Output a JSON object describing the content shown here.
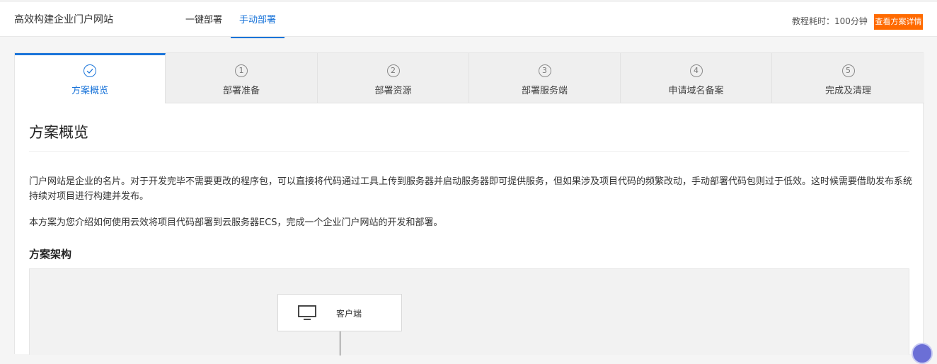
{
  "header": {
    "site_title": "高效构建企业门户网站",
    "tabs": [
      "一键部署",
      "手动部署"
    ],
    "active_tab": "手动部署",
    "time_label": "教程耗时：100分钟",
    "detail_button": "查看方案详情",
    "accent_color": "#1a74d9",
    "button_color": "#ff6a00"
  },
  "steps": [
    {
      "marker": "check-icon",
      "label": "方案概览"
    },
    {
      "marker": "1",
      "label": "部署准备"
    },
    {
      "marker": "2",
      "label": "部署资源"
    },
    {
      "marker": "3",
      "label": "部署服务端"
    },
    {
      "marker": "4",
      "label": "申请域名备案"
    },
    {
      "marker": "5",
      "label": "完成及清理"
    }
  ],
  "content": {
    "title": "方案概览",
    "paragraph1": "门户网站是企业的名片。对于开发完毕不需要更改的程序包，可以直接将代码通过工具上传到服务器并启动服务器即可提供服务，但如果涉及项目代码的频繁改动，手动部署代码包则过于低效。这时候需要借助发布系统持续对项目进行构建并发布。",
    "paragraph2": "本方案为您介绍如何使用云效将项目代码部署到云服务器ECS，完成一个企业门户网站的开发和部署。",
    "section_title": "方案架构",
    "diagram": {
      "client_icon": "monitor-icon",
      "client_label": "客户端"
    }
  }
}
